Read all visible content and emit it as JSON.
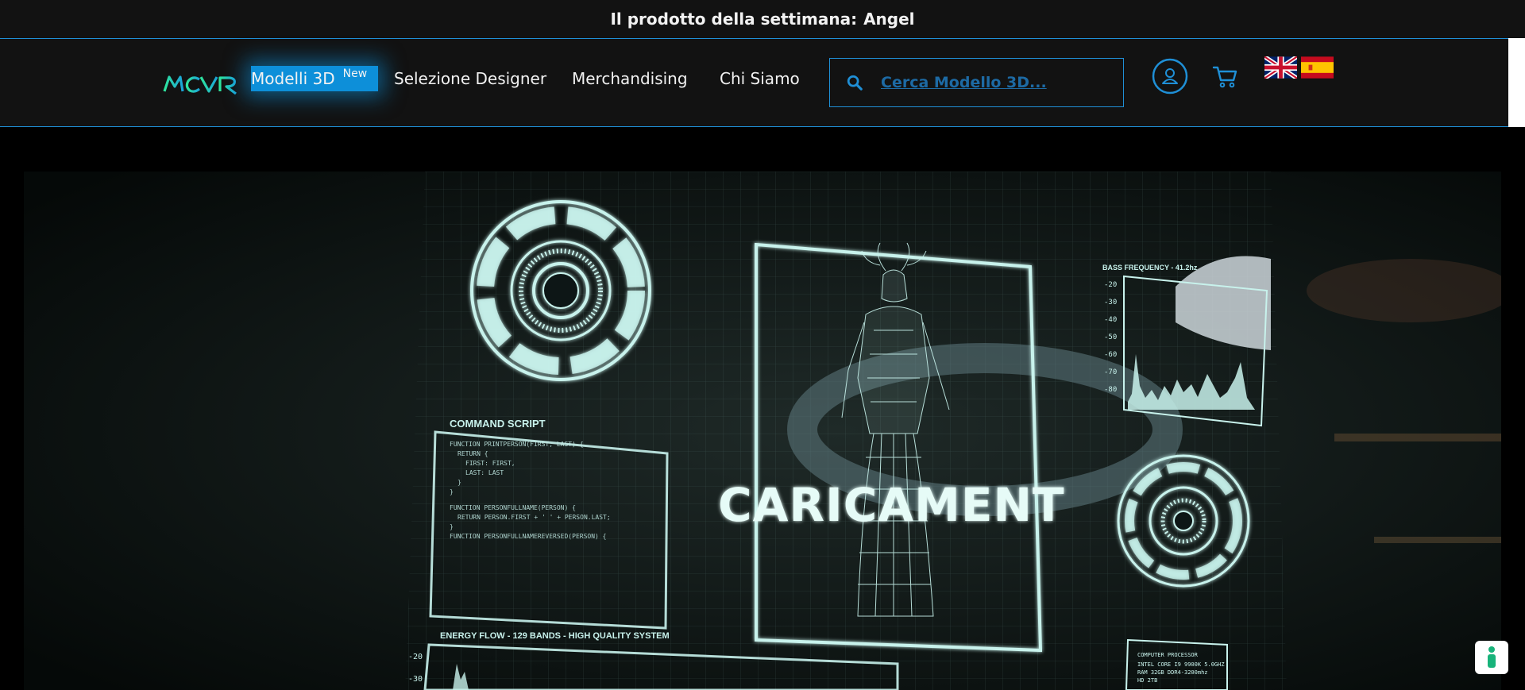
{
  "announcement": {
    "label": "Il prodotto della settimana:",
    "product": "Angel"
  },
  "logo": {
    "text": "MCVR"
  },
  "nav": {
    "items": [
      {
        "label": "Modelli 3D",
        "badge": "New"
      },
      {
        "label": "Selezione Designer"
      },
      {
        "label": "Merchandising"
      },
      {
        "label": "Chi Siamo"
      }
    ]
  },
  "search": {
    "placeholder": "Cerca Modello 3D..."
  },
  "icons": {
    "account": "user-circle-icon",
    "cart": "cart-icon",
    "flags": [
      "uk-flag-icon",
      "spain-flag-icon"
    ],
    "help": "accessibility-icon"
  },
  "hero": {
    "headline": "CARICAMENT",
    "panels": {
      "command_title": "COMMAND SCRIPT",
      "code_lines": [
        "FUNCTION PRINTPERSON(FIRST, LAST) {",
        "RETURN {",
        "FIRST: FIRST,",
        "LAST: LAST",
        "}",
        "}",
        "FUNCTION PERSONFULLNAME(PERSON) {",
        "RETURN PERSON.FIRST + ' ' + PERSON.LAST;",
        "}",
        "FUNCTION PERSONFULLNAMEREVERSED(PERSON) {"
      ],
      "energy_title": "ENERGY FLOW - 129 BANDS - HIGH QUALITY SYSTEM",
      "bass_title": "BASS FREQUENCY - 41.2hz",
      "bass_ticks": [
        "-20",
        "-30",
        "-40",
        "-50",
        "-60",
        "-70",
        "-80"
      ],
      "energy_ticks": [
        "-20",
        "-30"
      ],
      "processor_title": "COMPUTER PROCESSOR",
      "processor_lines": [
        "INTEL CORE I9 9900K 5.0GHZ",
        "RAM 32GB DDR4-3200mhz",
        "HD 2TB"
      ]
    }
  },
  "colors": {
    "accent": "#1f8fd6",
    "active_nav": "#0d8fd9",
    "logo_green": "#2ee59d",
    "hud": "#c8f2ec"
  }
}
